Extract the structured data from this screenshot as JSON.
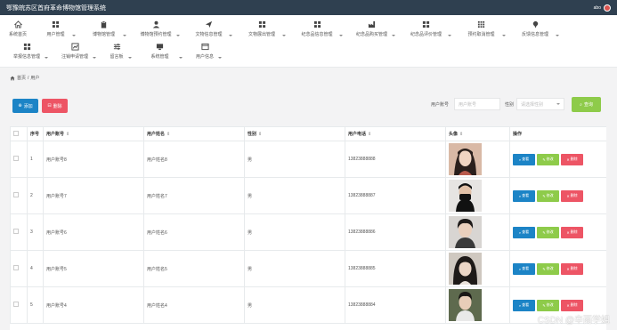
{
  "app": {
    "title": "鄂豫皖苏区首府革命博物馆管理系统",
    "user": "abo"
  },
  "nav": {
    "row1": [
      {
        "label": "系统首页",
        "icon": "home-icon",
        "caret": false
      },
      {
        "label": "用户管理",
        "icon": "grid-icon",
        "caret": true
      },
      {
        "label": "博物馆管理",
        "icon": "clipboard-icon",
        "caret": true
      },
      {
        "label": "博物馆预约管理",
        "icon": "user-icon",
        "caret": true
      },
      {
        "label": "文物信息管理",
        "icon": "send-icon",
        "caret": true
      },
      {
        "label": "文物展出管理",
        "icon": "grid-icon",
        "caret": true
      },
      {
        "label": "纪念品信息管理",
        "icon": "grid-icon",
        "caret": true
      },
      {
        "label": "纪念品购买管理",
        "icon": "factory-icon",
        "caret": true
      },
      {
        "label": "纪念品评价管理",
        "icon": "grid-icon",
        "caret": true
      },
      {
        "label": "预约取消管理",
        "icon": "apps-icon",
        "caret": true
      },
      {
        "label": "反馈信息管理",
        "icon": "pin-icon",
        "caret": true
      }
    ],
    "row2": [
      {
        "label": "举报信息管理",
        "icon": "grid-icon",
        "caret": true
      },
      {
        "label": "注销申请管理",
        "icon": "chart-icon",
        "caret": true
      },
      {
        "label": "留言板",
        "icon": "sliders-icon",
        "caret": true
      },
      {
        "label": "系统管理",
        "icon": "monitor-icon",
        "caret": true
      },
      {
        "label": "用户信息",
        "icon": "browser-icon",
        "caret": true
      }
    ]
  },
  "breadcrumb": {
    "home": "首页",
    "sep": "/",
    "current": "用户"
  },
  "toolbar": {
    "add_label": "添加",
    "delete_label": "删除",
    "account_label": "用户账号",
    "account_placeholder": "用户账号",
    "gender_label": "性别",
    "gender_placeholder": "请选择性别",
    "search_label": "查询"
  },
  "table": {
    "headers": {
      "index": "序号",
      "account": "用户账号",
      "name": "用户姓名",
      "gender": "性别",
      "phone": "用户电话",
      "avatar": "头像",
      "actions": "操作"
    },
    "sort_glyph": "⇕",
    "rows": [
      {
        "index": "1",
        "account": "用户账号8",
        "name": "用户姓名8",
        "gender": "男",
        "phone": "13823888888"
      },
      {
        "index": "2",
        "account": "用户账号7",
        "name": "用户姓名7",
        "gender": "男",
        "phone": "13823888887"
      },
      {
        "index": "3",
        "account": "用户账号6",
        "name": "用户姓名6",
        "gender": "男",
        "phone": "13823888886"
      },
      {
        "index": "4",
        "account": "用户账号5",
        "name": "用户姓名5",
        "gender": "男",
        "phone": "13823888885"
      },
      {
        "index": "5",
        "account": "用户账号4",
        "name": "用户姓名4",
        "gender": "男",
        "phone": "13823888884"
      }
    ],
    "action_labels": {
      "view": "查看",
      "edit": "修改",
      "delete": "删除"
    }
  },
  "watermark": "CSDN @辛雨学姐",
  "colors": {
    "topbar": "#2f4050",
    "primary": "#1c84c6",
    "danger": "#ed5565",
    "success": "#8ecb4a"
  }
}
